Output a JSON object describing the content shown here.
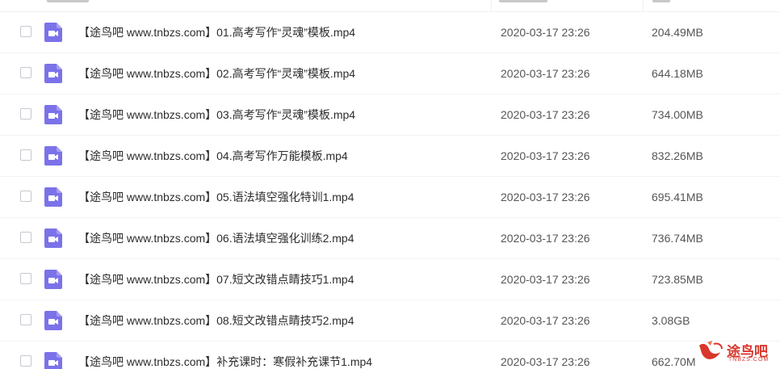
{
  "colors": {
    "video_icon": "#7b72e9",
    "watermark": "#d9362c"
  },
  "icons": {
    "file_type": "video-file-icon",
    "watermark_logo": "bird-logo-icon"
  },
  "files": [
    {
      "name": "【途鸟吧 www.tnbzs.com】01.高考写作“灵魂”模板.mp4",
      "date": "2020-03-17 23:26",
      "size": "204.49MB"
    },
    {
      "name": "【途鸟吧 www.tnbzs.com】02.高考写作“灵魂”模板.mp4",
      "date": "2020-03-17 23:26",
      "size": "644.18MB"
    },
    {
      "name": "【途鸟吧 www.tnbzs.com】03.高考写作“灵魂”模板.mp4",
      "date": "2020-03-17 23:26",
      "size": "734.00MB"
    },
    {
      "name": "【途鸟吧 www.tnbzs.com】04.高考写作万能模板.mp4",
      "date": "2020-03-17 23:26",
      "size": "832.26MB"
    },
    {
      "name": "【途鸟吧 www.tnbzs.com】05.语法填空强化特训1.mp4",
      "date": "2020-03-17 23:26",
      "size": "695.41MB"
    },
    {
      "name": "【途鸟吧 www.tnbzs.com】06.语法填空强化训练2.mp4",
      "date": "2020-03-17 23:26",
      "size": "736.74MB"
    },
    {
      "name": "【途鸟吧 www.tnbzs.com】07.短文改错点睛技巧1.mp4",
      "date": "2020-03-17 23:26",
      "size": "723.85MB"
    },
    {
      "name": "【途鸟吧 www.tnbzs.com】08.短文改错点睛技巧2.mp4",
      "date": "2020-03-17 23:26",
      "size": "3.08GB"
    },
    {
      "name": "【途鸟吧 www.tnbzs.com】补充课时：寒假补充课节1.mp4",
      "date": "2020-03-17 23:26",
      "size": "662.70M"
    }
  ],
  "watermark": {
    "main": "途鸟吧",
    "sub": "TNBZS.COM"
  }
}
